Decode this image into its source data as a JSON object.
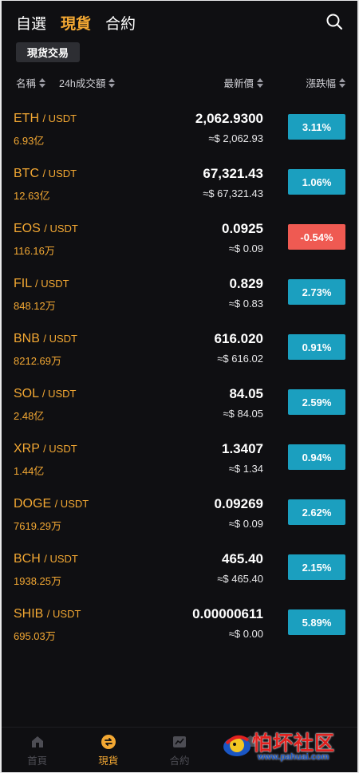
{
  "header": {
    "tabs": [
      {
        "label": "自選",
        "active": false
      },
      {
        "label": "現貨",
        "active": true
      },
      {
        "label": "合約",
        "active": false
      }
    ],
    "search_icon": "search-icon",
    "sub_chip": "現货交易"
  },
  "sort_headers": {
    "name": "名稱",
    "volume": "24h成交額",
    "price": "最新價",
    "change": "漲跌幅"
  },
  "markets": [
    {
      "base": "ETH",
      "quote": "/ USDT",
      "volume": "6.93亿",
      "price": "2,062.9300",
      "approx": "≈$ 2,062.93",
      "change": "3.11%",
      "direction": "up"
    },
    {
      "base": "BTC",
      "quote": "/ USDT",
      "volume": "12.63亿",
      "price": "67,321.43",
      "approx": "≈$ 67,321.43",
      "change": "1.06%",
      "direction": "up"
    },
    {
      "base": "EOS",
      "quote": "/ USDT",
      "volume": "116.16万",
      "price": "0.0925",
      "approx": "≈$ 0.09",
      "change": "-0.54%",
      "direction": "down"
    },
    {
      "base": "FIL",
      "quote": "/ USDT",
      "volume": "848.12万",
      "price": "0.829",
      "approx": "≈$ 0.83",
      "change": "2.73%",
      "direction": "up"
    },
    {
      "base": "BNB",
      "quote": "/ USDT",
      "volume": "8212.69万",
      "price": "616.020",
      "approx": "≈$ 616.02",
      "change": "0.91%",
      "direction": "up"
    },
    {
      "base": "SOL",
      "quote": "/ USDT",
      "volume": "2.48亿",
      "price": "84.05",
      "approx": "≈$ 84.05",
      "change": "2.59%",
      "direction": "up"
    },
    {
      "base": "XRP",
      "quote": "/ USDT",
      "volume": "1.44亿",
      "price": "1.3407",
      "approx": "≈$ 1.34",
      "change": "0.94%",
      "direction": "up"
    },
    {
      "base": "DOGE",
      "quote": "/ USDT",
      "volume": "7619.29万",
      "price": "0.09269",
      "approx": "≈$ 0.09",
      "change": "2.62%",
      "direction": "up"
    },
    {
      "base": "BCH",
      "quote": "/ USDT",
      "volume": "1938.25万",
      "price": "465.40",
      "approx": "≈$ 465.40",
      "change": "2.15%",
      "direction": "up"
    },
    {
      "base": "SHIB",
      "quote": "/ USDT",
      "volume": "695.03万",
      "price": "0.00000611",
      "approx": "≈$ 0.00",
      "change": "5.89%",
      "direction": "up"
    }
  ],
  "bottom_nav": [
    {
      "label": "首頁",
      "icon": "home-icon",
      "active": false
    },
    {
      "label": "現貨",
      "icon": "spot-exchange-icon",
      "active": true
    },
    {
      "label": "合約",
      "icon": "contract-chart-icon",
      "active": false
    },
    {
      "label": "",
      "icon": "wallet-icon",
      "active": false
    },
    {
      "label": "",
      "icon": "profile-icon",
      "active": false
    }
  ],
  "watermark": {
    "text": "怕坏社区",
    "url": "www.pahuai.com",
    "logo_icon": "pahuai-logo-icon"
  },
  "colors": {
    "background": "#0f0f12",
    "accent": "#f3a833",
    "up": "#1b9fbf",
    "down": "#ef5a52",
    "chip": "#2d2e33"
  }
}
